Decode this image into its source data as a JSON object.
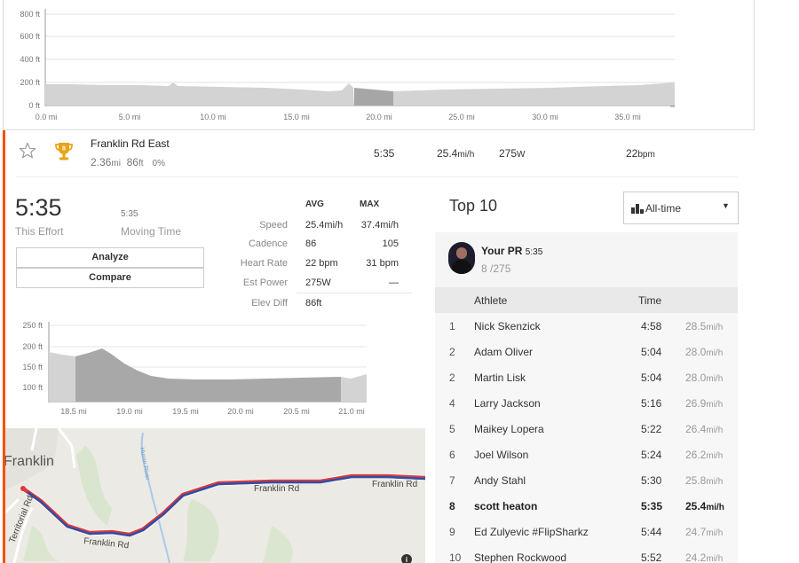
{
  "elevation_chart": {
    "y_ticks": [
      "800 ft",
      "600 ft",
      "400 ft",
      "200 ft",
      "0 ft"
    ],
    "x_ticks": [
      "0.0 mi",
      "5.0 mi",
      "10.0 mi",
      "15.0 mi",
      "20.0 mi",
      "25.0 mi",
      "30.0 mi",
      "35.0 mi"
    ],
    "highlight_range_mi": [
      18.5,
      21.0
    ]
  },
  "segment": {
    "name": "Franklin Rd East",
    "distance_value": "2.36",
    "distance_unit": "mi",
    "elev_value": "86",
    "elev_unit": "ft",
    "grade": "0%",
    "time": "5:35",
    "speed_value": "25.4",
    "speed_unit": "mi/h",
    "power_value": "275",
    "power_unit": "W",
    "hr_value": "22",
    "hr_unit": "bpm",
    "badge_rank": "8"
  },
  "effort": {
    "time": "5:35",
    "time_label": "This Effort",
    "moving_time": "5:35",
    "moving_time_label": "Moving Time",
    "analyze_label": "Analyze",
    "compare_label": "Compare"
  },
  "stats": {
    "avg_header": "AVG",
    "max_header": "MAX",
    "rows": [
      {
        "label": "Speed",
        "avg": "25.4mi/h",
        "max": "37.4mi/h"
      },
      {
        "label": "Cadence",
        "avg": "86",
        "max": "105"
      },
      {
        "label": "Heart Rate",
        "avg": "22 bpm",
        "max": "31 bpm"
      },
      {
        "label": "Est Power",
        "avg": "275W",
        "max": "—"
      },
      {
        "label": "Elev Diff",
        "avg": "86ft",
        "max": ""
      }
    ]
  },
  "segment_elev_chart": {
    "y_ticks": [
      "250 ft",
      "200 ft",
      "150 ft",
      "100 ft"
    ],
    "x_ticks": [
      "18.5 mi",
      "19.0 mi",
      "19.5 mi",
      "20.0 mi",
      "20.5 mi",
      "21.0 mi"
    ]
  },
  "map": {
    "town_label": "Franklin",
    "road_labels": [
      "Franklin Rd",
      "Franklin Rd",
      "Franklin Rd",
      "Territorial Rd"
    ],
    "river_label": "Huron River"
  },
  "leaderboard": {
    "title": "Top 10",
    "filter_label": "All-time",
    "pr_label": "Your PR",
    "pr_time": "5:35",
    "pr_rank": "8",
    "pr_total": "/275",
    "col_athlete": "Athlete",
    "col_time": "Time",
    "rows": [
      {
        "rank": "1",
        "name": "Nick Skenzick",
        "time": "4:58",
        "speed": "28.5",
        "unit": "mi/h"
      },
      {
        "rank": "2",
        "name": "Adam Oliver",
        "time": "5:04",
        "speed": "28.0",
        "unit": "mi/h"
      },
      {
        "rank": "2",
        "name": "Martin Lisk",
        "time": "5:04",
        "speed": "28.0",
        "unit": "mi/h"
      },
      {
        "rank": "4",
        "name": "Larry Jackson",
        "time": "5:16",
        "speed": "26.9",
        "unit": "mi/h"
      },
      {
        "rank": "5",
        "name": "Maikey Lopera",
        "time": "5:22",
        "speed": "26.4",
        "unit": "mi/h"
      },
      {
        "rank": "6",
        "name": "Joel Wilson",
        "time": "5:24",
        "speed": "26.2",
        "unit": "mi/h"
      },
      {
        "rank": "7",
        "name": "Andy Stahl",
        "time": "5:30",
        "speed": "25.8",
        "unit": "mi/h"
      },
      {
        "rank": "8",
        "name": "scott heaton",
        "time": "5:35",
        "speed": "25.4",
        "unit": "mi/h"
      },
      {
        "rank": "9",
        "name": "Ed Zulyevic #FlipSharkz",
        "time": "5:44",
        "speed": "24.7",
        "unit": "mi/h"
      },
      {
        "rank": "10",
        "name": "Stephen Rockwood",
        "time": "5:52",
        "speed": "24.2",
        "unit": "mi/h"
      }
    ]
  }
}
